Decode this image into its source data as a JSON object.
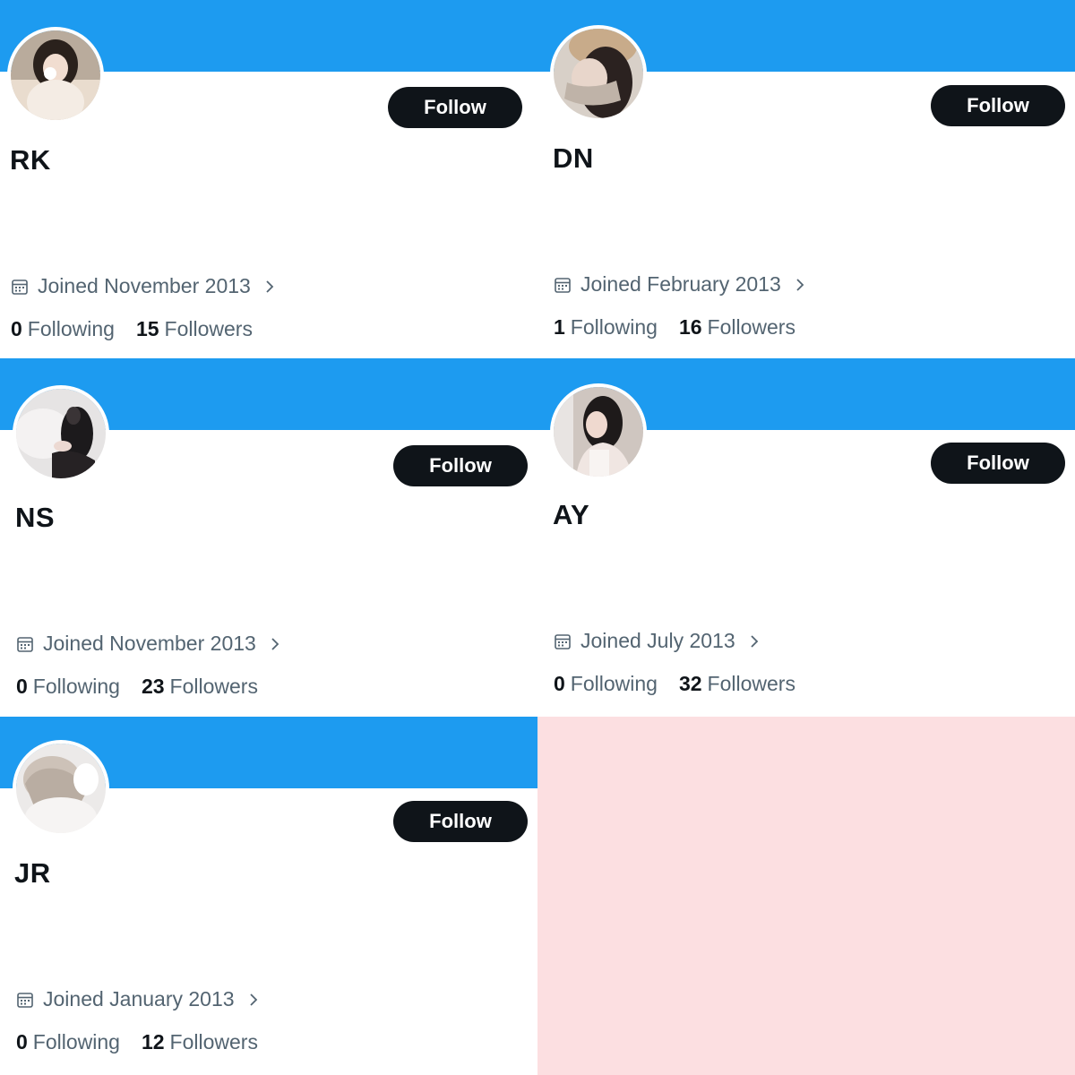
{
  "colors": {
    "banner": "#1d9bf0",
    "follow_button": "#0f1419",
    "muted_text": "#536471",
    "empty_panel": "#fcdfe1"
  },
  "profiles": [
    {
      "display_name": "RK",
      "follow_label": "Follow",
      "joined": "Joined November 2013",
      "following_count": "0",
      "following_label": "Following",
      "followers_count": "15",
      "followers_label": "Followers",
      "icons": {
        "calendar": "calendar-icon",
        "chevron": "chevron-right-icon"
      }
    },
    {
      "display_name": "DN",
      "follow_label": "Follow",
      "joined": "Joined February 2013",
      "following_count": "1",
      "following_label": "Following",
      "followers_count": "16",
      "followers_label": "Followers",
      "icons": {
        "calendar": "calendar-icon",
        "chevron": "chevron-right-icon"
      }
    },
    {
      "display_name": "NS",
      "follow_label": "Follow",
      "joined": "Joined November 2013",
      "following_count": "0",
      "following_label": "Following",
      "followers_count": "23",
      "followers_label": "Followers",
      "icons": {
        "calendar": "calendar-icon",
        "chevron": "chevron-right-icon"
      }
    },
    {
      "display_name": "AY",
      "follow_label": "Follow",
      "joined": "Joined July 2013",
      "following_count": "0",
      "following_label": "Following",
      "followers_count": "32",
      "followers_label": "Followers",
      "icons": {
        "calendar": "calendar-icon",
        "chevron": "chevron-right-icon"
      }
    },
    {
      "display_name": "JR",
      "follow_label": "Follow",
      "joined": "Joined January 2013",
      "following_count": "0",
      "following_label": "Following",
      "followers_count": "12",
      "followers_label": "Followers",
      "icons": {
        "calendar": "calendar-icon",
        "chevron": "chevron-right-icon"
      }
    }
  ]
}
